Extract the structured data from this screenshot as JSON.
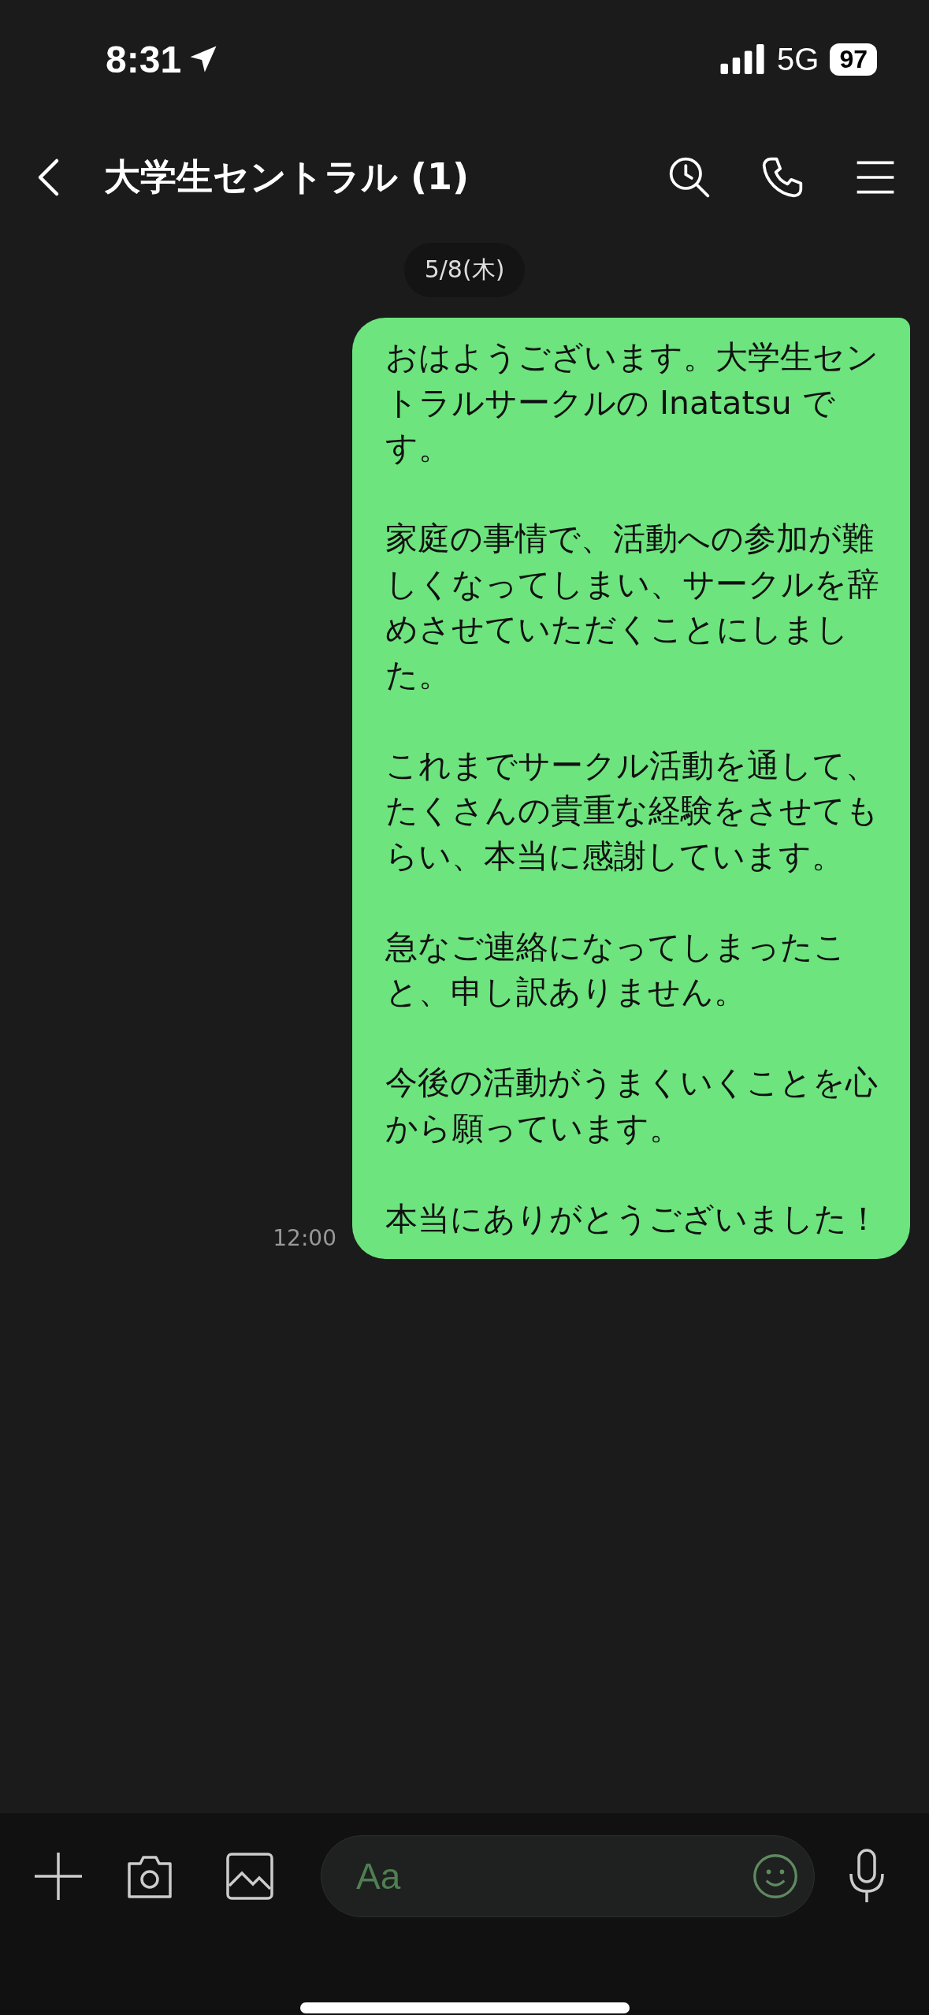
{
  "status_bar": {
    "time": "8:31",
    "network": "5G",
    "battery": "97"
  },
  "header": {
    "title": "大学生セントラル (1)"
  },
  "date_chip": "5/8(木)",
  "messages": [
    {
      "kind": "sent",
      "paragraphs": [
        "おはようございます。大学生セントラルサークルの Inatatsu です。",
        "家庭の事情で、活動への参加が難しくなってしまい、サークルを辞めさせていただくことにしました。",
        "これまでサークル活動を通して、たくさんの貴重な経験をさせてもらい、本当に感謝しています。",
        "急なご連絡になってしまったこと、申し訳ありません。",
        "今後の活動がうまくいくことを心から願っています。",
        "本当にありがとうございました！"
      ],
      "time": "12:00"
    }
  ],
  "composer": {
    "placeholder": "Aa"
  }
}
